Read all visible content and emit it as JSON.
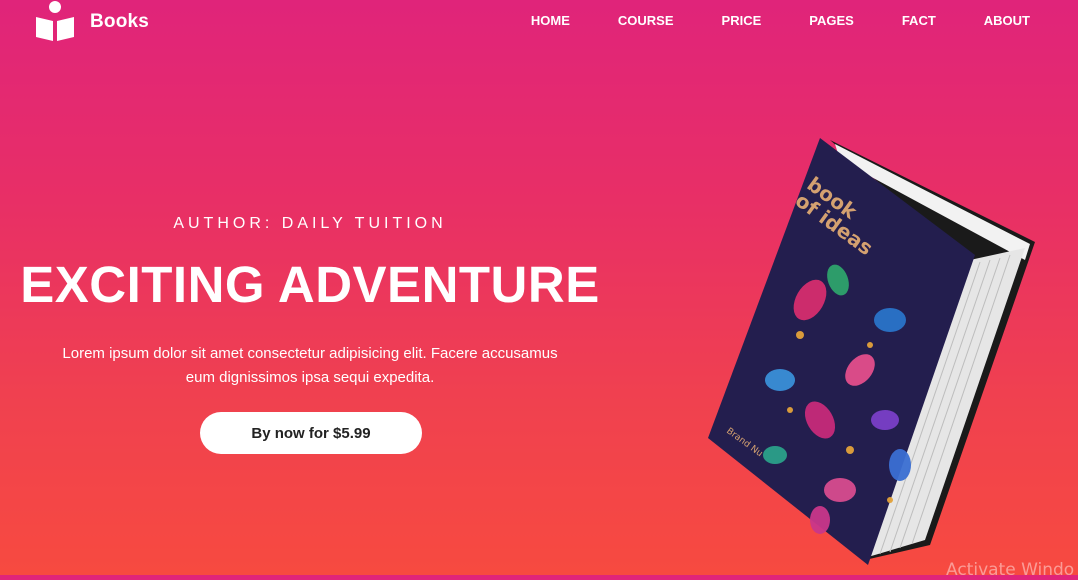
{
  "brand": {
    "name": "Books"
  },
  "nav": {
    "items": [
      "HOME",
      "COURSE",
      "PRICE",
      "PAGES",
      "FACT",
      "ABOUT"
    ]
  },
  "hero": {
    "author": "AUTHOR: DAILY TUITION",
    "title": "EXCITING ADVENTURE",
    "description_line1": "Lorem ipsum dolor sit amet consectetur adipisicing elit. Facere accusamus",
    "description_line2": "eum dignissimos ipsa sequi expedita.",
    "cta_label": "By now for $5.99"
  },
  "book": {
    "title_line1": "book",
    "title_line2": "of ideas",
    "brand": "Brand Nu"
  },
  "overlay": {
    "activate_text": "Activate Windo"
  },
  "colors": {
    "gradient_top": "#e0247a",
    "gradient_bottom": "#f74a40",
    "book_cover": "#231e4e"
  }
}
